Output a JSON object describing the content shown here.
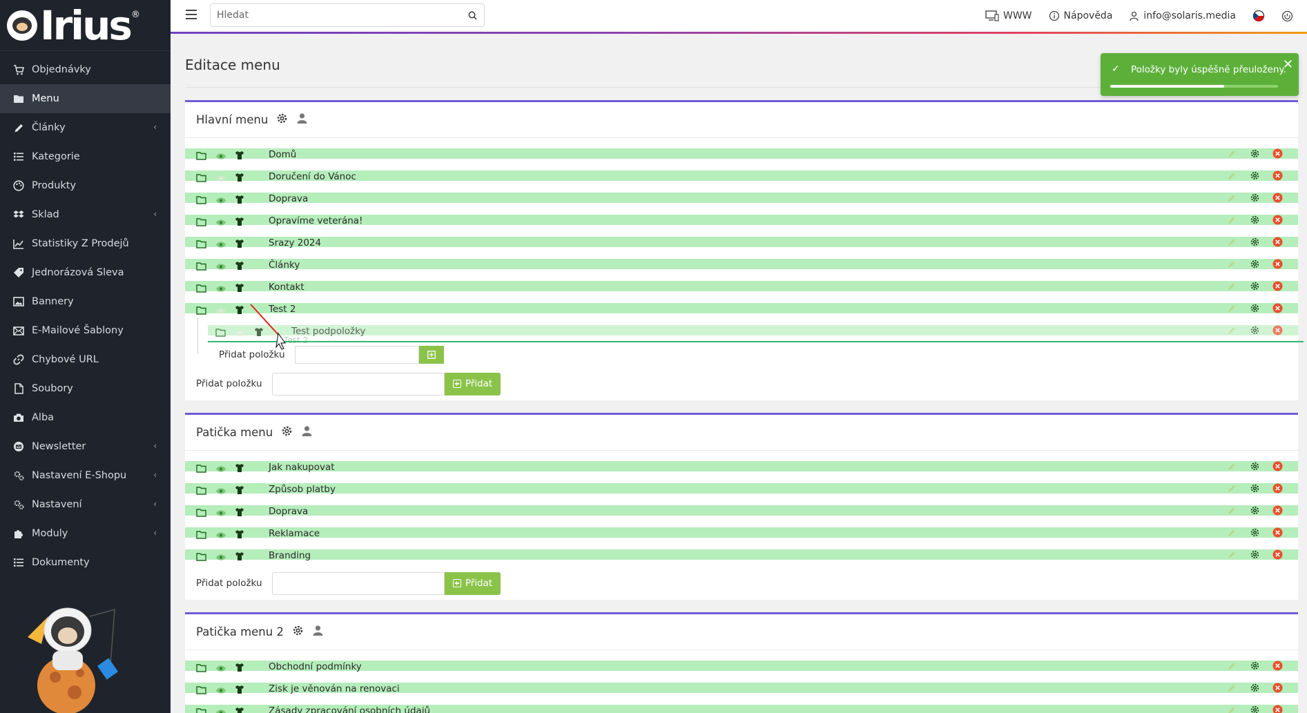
{
  "app": {
    "logo_text": "Irius",
    "logo_mark": "®"
  },
  "sidebar": {
    "items": [
      {
        "label": "Objednávky",
        "icon": "cart-icon",
        "submenu": false
      },
      {
        "label": "Menu",
        "icon": "folder-icon",
        "submenu": false,
        "active": true
      },
      {
        "label": "Články",
        "icon": "pencil-icon",
        "submenu": true
      },
      {
        "label": "Kategorie",
        "icon": "list-icon",
        "submenu": false
      },
      {
        "label": "Produkty",
        "icon": "palette-icon",
        "submenu": false
      },
      {
        "label": "Sklad",
        "icon": "dropbox-icon",
        "submenu": true
      },
      {
        "label": "Statistiky Z Prodejů",
        "icon": "line-chart-icon",
        "submenu": false
      },
      {
        "label": "Jednorázová Sleva",
        "icon": "tag-icon",
        "submenu": false
      },
      {
        "label": "Bannery",
        "icon": "image-icon",
        "submenu": false
      },
      {
        "label": "E-Mailové Šablony",
        "icon": "envelope-icon",
        "submenu": false
      },
      {
        "label": "Chybové URL",
        "icon": "link-icon",
        "submenu": false
      },
      {
        "label": "Soubory",
        "icon": "file-icon",
        "submenu": false
      },
      {
        "label": "Alba",
        "icon": "camera-icon",
        "submenu": false
      },
      {
        "label": "Newsletter",
        "icon": "mail-circle-icon",
        "submenu": true
      },
      {
        "label": "Nastavení E-Shopu",
        "icon": "cogs-icon",
        "submenu": true
      },
      {
        "label": "Nastavení",
        "icon": "cogs-icon",
        "submenu": true
      },
      {
        "label": "Moduly",
        "icon": "puzzle-icon",
        "submenu": true
      },
      {
        "label": "Dokumenty",
        "icon": "list-icon",
        "submenu": false
      }
    ]
  },
  "topbar": {
    "search_placeholder": "Hledat",
    "www_label": "WWW",
    "help_label": "Nápověda",
    "user_label": "info@solaris.media"
  },
  "page": {
    "title": "Editace menu"
  },
  "toast": {
    "message": "Položky byly úspěšně přeuloženy.",
    "progress": 0.68
  },
  "menus": [
    {
      "title": "Hlavní menu",
      "items": [
        "Domů",
        "Doručení do Vánoc",
        "Doprava",
        "Opravíme veterána!",
        "Srazy 2024",
        "Články",
        "Kontakt",
        "Test 2"
      ],
      "hidden": [
        false,
        true,
        false,
        false,
        false,
        false,
        false,
        true
      ],
      "child": {
        "label": "Test podpoložky",
        "ghost_label": "Test 2",
        "add_label": "Přidat položku"
      },
      "add_label": "Přidat položku",
      "add_button": "Přidat"
    },
    {
      "title": "Patička menu",
      "items": [
        "Jak nakupovat",
        "Způsob platby",
        "Doprava",
        "Reklamace",
        "Branding"
      ],
      "add_label": "Přidat položku",
      "add_button": "Přidat"
    },
    {
      "title": "Patička menu 2",
      "items": [
        "Obchodní podmínky",
        "Zisk je věnován na renovaci",
        "Zásady zpracování osobních údajů"
      ]
    }
  ],
  "colors": {
    "sidebar_bg": "#1f232b",
    "row_green": "#b5edbb",
    "accent_purple": "#6f5bd6",
    "add_button": "#8bc34a",
    "toast_bg": "#5cb03a",
    "delete_red": "#e8502f"
  }
}
